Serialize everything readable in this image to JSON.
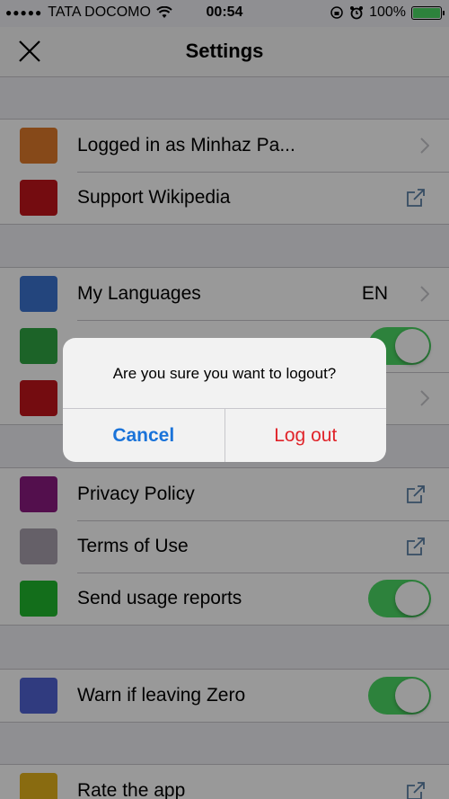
{
  "status_bar": {
    "carrier": "TATA DOCOMO",
    "time": "00:54",
    "battery": "100%"
  },
  "nav": {
    "title": "Settings"
  },
  "groups": [
    {
      "rows": [
        {
          "label": "Logged in as Minhaz Pa...",
          "icon_color": "#e07b2a",
          "accessory": "chevron"
        },
        {
          "label": "Support Wikipedia",
          "icon_color": "#c2141b",
          "accessory": "external-link"
        }
      ]
    },
    {
      "rows": [
        {
          "label": "My Languages",
          "value": "EN",
          "icon_color": "#3b74d0",
          "accessory": "chevron"
        },
        {
          "label": "",
          "icon_color": "#2fa544",
          "accessory": "toggle",
          "toggle_on": true
        },
        {
          "label": "",
          "icon_color": "#c2141b",
          "accessory": "chevron"
        }
      ]
    },
    {
      "rows": [
        {
          "label": "Privacy Policy",
          "icon_color": "#8a1a80",
          "accessory": "external-link"
        },
        {
          "label": "Terms of Use",
          "icon_color": "#a8a0ad",
          "accessory": "external-link"
        },
        {
          "label": "Send usage reports",
          "icon_color": "#21b82d",
          "accessory": "toggle",
          "toggle_on": true
        }
      ]
    },
    {
      "rows": [
        {
          "label": "Warn if leaving Zero",
          "icon_color": "#5163d4",
          "accessory": "toggle",
          "toggle_on": true
        }
      ]
    },
    {
      "rows": [
        {
          "label": "Rate the app",
          "icon_color": "#e5b21b",
          "accessory": "external-link"
        }
      ]
    }
  ],
  "alert": {
    "message": "Are you sure you want to logout?",
    "cancel_label": "Cancel",
    "logout_label": "Log out"
  }
}
